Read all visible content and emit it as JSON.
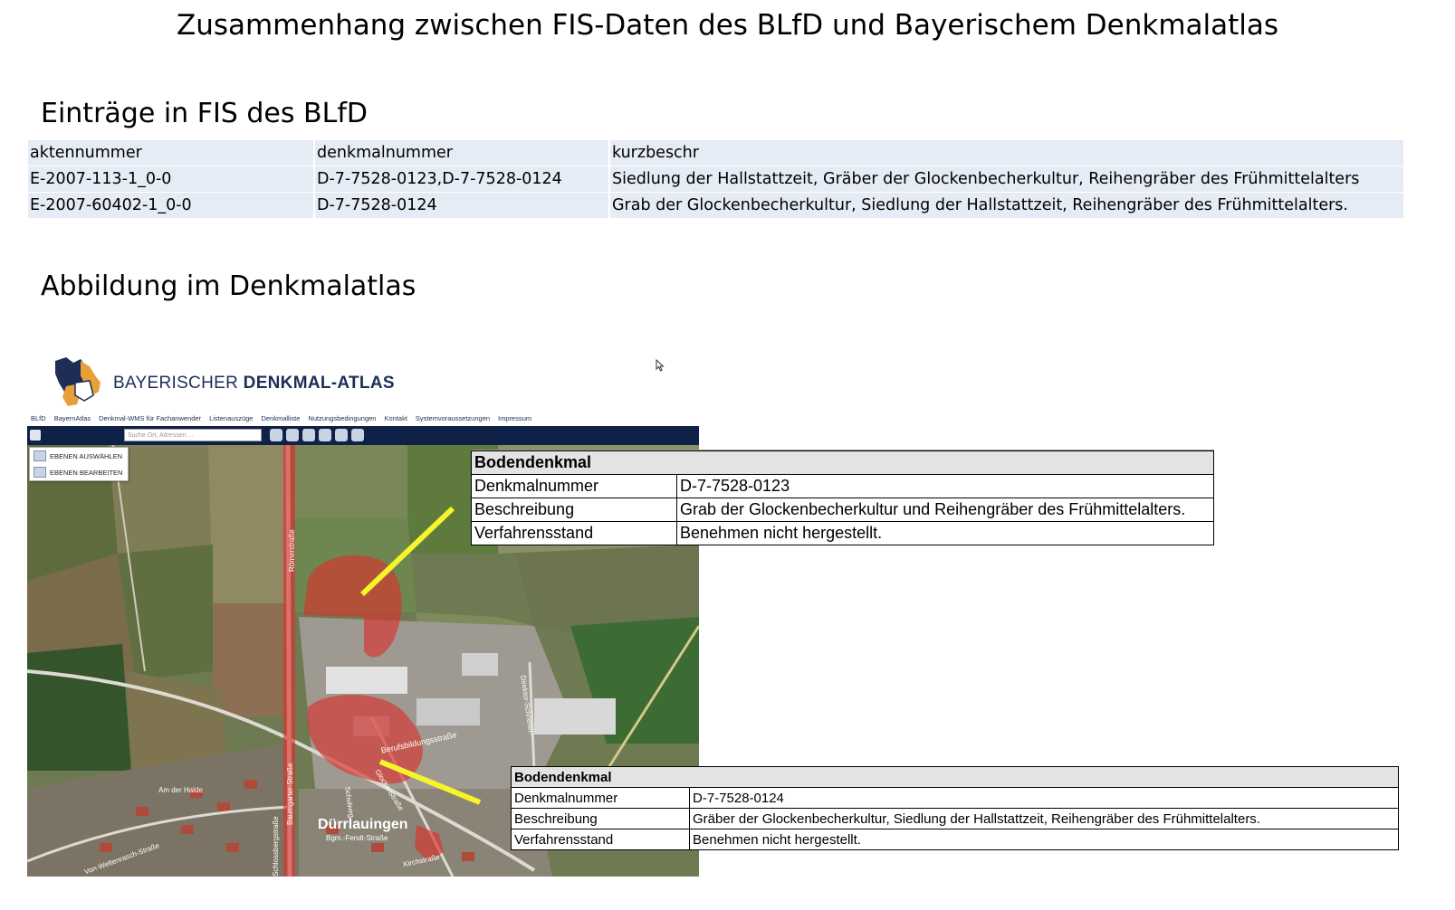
{
  "title": "Zusammenhang zwischen FIS-Daten des BLfD und Bayerischem Denkmalatlas",
  "fis_section": {
    "heading": "Einträge in FIS des BLfD",
    "columns": [
      "aktennummer",
      "denkmalnummer",
      "kurzbeschr"
    ],
    "rows": [
      [
        "E-2007-113-1_0-0",
        "D-7-7528-0123,D-7-7528-0124",
        "Siedlung der Hallstattzeit, Gräber der Glockenbecherkultur, Reihengräber des Frühmittelalters"
      ],
      [
        "E-2007-60402-1_0-0",
        "D-7-7528-0124",
        "Grab der Glockenbecherkultur, Siedlung der Hallstattzeit, Reihengräber des Frühmittelalters."
      ]
    ]
  },
  "atlas_section": {
    "heading": "Abbildung im Denkmalatlas"
  },
  "atlas": {
    "logo_light": "BAYERISCHER ",
    "logo_bold": "DENKMAL-ATLAS",
    "nav": [
      "BLfD",
      "BayernAtlas",
      "Denkmal-WMS für Fachanwender",
      "Listenauszüge",
      "Denkmalliste",
      "Nutzungsbedingungen",
      "Kontakt",
      "Systemvoraussetzungen",
      "Impressum"
    ],
    "search_placeholder": "Suche Ort, Adressen ...",
    "layer_buttons": [
      "EBENEN AUSWÄHLEN",
      "EBENEN BEARBEITEN"
    ],
    "map_labels": {
      "roemerstrasse": "Römerstraße",
      "baumgarter": "Baumgarter-Straße",
      "berufsbildung": "Berufsbildungsstraße",
      "direktor": "Direktor-Schneller-",
      "schulweg": "Schulweg",
      "am_der_halde": "Am der Halde",
      "town": "Dürrlauingen",
      "bgm": "Bgm.-Fendt-Straße",
      "kirchstrasse": "Kirchstraße",
      "weltenrasch": "Von-Weltenrasch-Straße",
      "schlossberg": "Schlossbergstraße",
      "ringstrasse": "Ringstraße",
      "glockenstrasse": "Glockenstraße"
    },
    "colors": {
      "monument_area": "#d9332e",
      "arrow": "#f5f52a",
      "header_bar": "#0f2147"
    }
  },
  "popups": [
    {
      "header": "Bodendenkmal",
      "rows": [
        [
          "Denkmalnummer",
          "D-7-7528-0123"
        ],
        [
          "Beschreibung",
          "Grab der Glockenbecherkultur und Reihengräber des Frühmittelalters."
        ],
        [
          "Verfahrensstand",
          "Benehmen nicht hergestellt."
        ]
      ]
    },
    {
      "header": "Bodendenkmal",
      "rows": [
        [
          "Denkmalnummer",
          "D-7-7528-0124"
        ],
        [
          "Beschreibung",
          "Gräber der Glockenbecherkultur, Siedlung der Hallstattzeit, Reihengräber des Frühmittelalters."
        ],
        [
          "Verfahrensstand",
          "Benehmen nicht hergestellt."
        ]
      ]
    }
  ]
}
